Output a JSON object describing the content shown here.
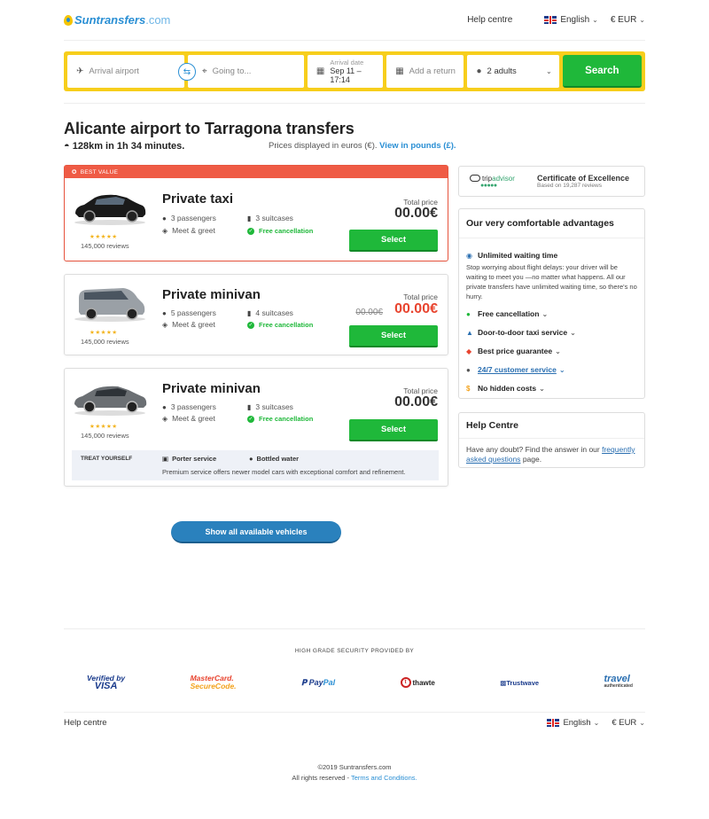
{
  "header": {
    "logo_main": "Suntransfers",
    "logo_suffix": ".com",
    "help": "Help centre",
    "language": "English",
    "currency": "€ EUR"
  },
  "search": {
    "from_placeholder": "Arrival airport",
    "to_placeholder": "Going to...",
    "date_label": "Arrival date",
    "date_value": "Sep 11 – 17:14",
    "return_placeholder": "Add a return",
    "passengers": "2 adults",
    "button": "Search"
  },
  "title": "Alicante airport to Tarragona transfers",
  "distance": "128km in 1h 34 minutes.",
  "prices_note": "Prices displayed in euros (€).",
  "prices_link": "View in pounds (£).",
  "cards": [
    {
      "badge": "BEST VALUE",
      "name": "Private taxi",
      "passengers": "3 passengers",
      "suitcases": "3 suitcases",
      "meet": "Meet & greet",
      "free": "Free cancellation",
      "stars": "★★★★★",
      "reviews": "145,000 reviews",
      "total_label": "Total price",
      "price": "00.00€",
      "select": "Select"
    },
    {
      "name": "Private minivan",
      "passengers": "5 passengers",
      "suitcases": "4 suitcases",
      "meet": "Meet & greet",
      "free": "Free cancellation",
      "stars": "★★★★★",
      "reviews": "145,000 reviews",
      "total_label": "Total price",
      "old_price": "00.00€",
      "price": "00.00€",
      "select": "Select"
    },
    {
      "name": "Private minivan",
      "passengers": "3 passengers",
      "suitcases": "3 suitcases",
      "meet": "Meet & greet",
      "free": "Free cancellation",
      "stars": "★★★★★",
      "reviews": "145,000 reviews",
      "total_label": "Total price",
      "price": "00.00€",
      "select": "Select",
      "treat": {
        "label": "TREAT YOURSELF",
        "porter": "Porter service",
        "water": "Bottled water",
        "desc": "Premium service offers newer model cars with exceptional comfort and refinement."
      }
    }
  ],
  "show_all": "Show all available vehicles",
  "sidebar": {
    "ta_name_prefix": "trip",
    "ta_name_suffix": "advisor",
    "ta_title": "Certificate of Excellence",
    "ta_sub": "Based on 19,287 reviews",
    "adv_title": "Our very comfortable advantages",
    "waiting_title": "Unlimited waiting time",
    "waiting_desc": "Stop worrying about flight delays: your driver will be waiting to meet you —no matter what happens. All our private transfers have unlimited waiting time, so there's no hurry.",
    "items": [
      "Free cancellation",
      "Door-to-door taxi service",
      "Best price guarantee",
      "24/7 customer service",
      "No hidden costs"
    ],
    "help_title": "Help Centre",
    "help_text": "Have any doubt? Find the answer in our",
    "help_link": "frequently asked questions",
    "help_end": "page."
  },
  "footer": {
    "secure": "HIGH GRADE SECURITY PROVIDED BY",
    "visa_top": "Verified by",
    "visa_bottom": "VISA",
    "mc_top": "MasterCard.",
    "mc_bottom": "SecureCode.",
    "paypal_a": "Pay",
    "paypal_b": "Pal",
    "thawte": "thawte",
    "trustwave": "Trustwave",
    "travel": "travel",
    "travel_sub": "authenticated",
    "help": "Help centre",
    "language": "English",
    "currency": "€ EUR",
    "copyright": "©2019 Suntransfers.com",
    "rights": "All rights reserved -",
    "terms": "Terms and Conditions."
  },
  "colors": {
    "search_bg": "#f7ce1c",
    "green": "#1fb83a",
    "best_value": "#ef5b45",
    "blue": "#2a81bd"
  }
}
